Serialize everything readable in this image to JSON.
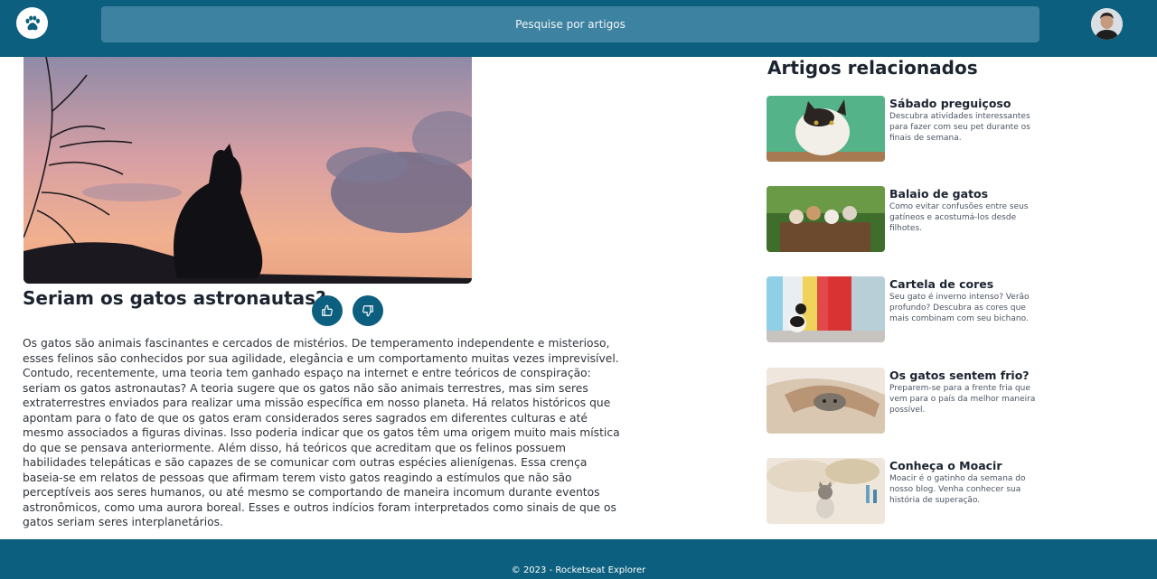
{
  "header": {
    "search_placeholder": "Pesquise por artigos",
    "logo_icon": "paw-icon",
    "avatar": "user-avatar"
  },
  "article": {
    "title": "Seriam os gatos astronautas?",
    "like_icon": "thumbs-up-icon",
    "dislike_icon": "thumbs-down-icon",
    "body": "Os gatos são animais fascinantes e cercados de mistérios. De temperamento independente e misterioso, esses felinos são conhecidos por sua agilidade, elegância e um comportamento muitas vezes imprevisível. Contudo, recentemente, uma teoria tem ganhado espaço na internet e entre teóricos de conspiração: seriam os gatos astronautas? A teoria sugere que os gatos não são animais terrestres, mas sim seres extraterrestres enviados para realizar uma missão específica em nosso planeta. Há relatos históricos que apontam para o fato de que os gatos eram considerados seres sagrados em diferentes culturas e até mesmo associados a figuras divinas. Isso poderia indicar que os gatos têm uma origem muito mais mística do que se pensava anteriormente. Além disso, há teóricos que acreditam que os felinos possuem habilidades telepáticas e são capazes de se comunicar com outras espécies alienígenas. Essa crença baseia-se em relatos de pessoas que afirmam terem visto gatos reagindo a estímulos que não são perceptíveis aos seres humanos, ou até mesmo se comportando de maneira incomum durante eventos astronômicos, como uma aurora boreal. Esses e outros indícios foram interpretados como sinais de que os gatos seriam seres interplanetários."
  },
  "related": {
    "title": "Artigos relacionados",
    "items": [
      {
        "title": "Sábado preguiçoso",
        "description": "Descubra atividades interessantes para fazer com seu pet durante os finais de semana."
      },
      {
        "title": "Balaio de gatos",
        "description": "Como evitar confusões entre seus gatíneos e acostumá-los desde filhotes."
      },
      {
        "title": "Cartela de cores",
        "description": "Seu gato é inverno intenso? Verão profundo? Descubra as cores que mais combinam com seu bichano."
      },
      {
        "title": "Os gatos sentem frio?",
        "description": "Preparem-se para a frente fria que vem para o país da melhor maneira possível."
      },
      {
        "title": "Conheça o Moacir",
        "description": "Moacir é o gatinho da semana do nosso blog. Venha conhecer sua história de superação."
      }
    ]
  },
  "footer": {
    "copyright": "© 2023 - Rocketseat Explorer"
  },
  "colors": {
    "primary": "#0c5f7e",
    "search_bg": "#3d82a0"
  }
}
